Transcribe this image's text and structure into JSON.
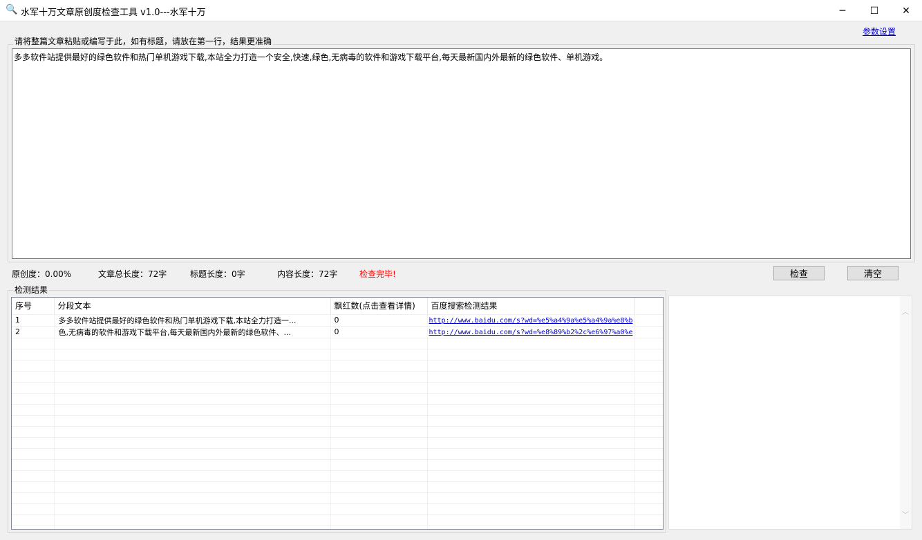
{
  "window": {
    "title": "水军十万文章原创度检查工具  v1.0---水军十万",
    "minimize": "─",
    "maximize": "☐",
    "close": "✕"
  },
  "settings_link": "参数设置",
  "input_group": {
    "label": "请将整篇文章粘贴或编写于此，如有标题，请放在第一行，结果更准确",
    "text": "多多软件站提供最好的绿色软件和热门单机游戏下载,本站全力打造一个安全,快速,绿色,无病毒的软件和游戏下载平台,每天最新国内外最新的绿色软件、单机游戏。"
  },
  "status": {
    "originality": "原创度：0.00%",
    "total_length": "文章总长度：72字",
    "title_length": "标题长度：0字",
    "content_length": "内容长度：72字",
    "message": "检查完毕!",
    "message_color": "#ff0000"
  },
  "buttons": {
    "check": "检查",
    "clear": "清空"
  },
  "results": {
    "label": "检测结果",
    "columns": [
      "序号",
      "分段文本",
      "飘红数(点击查看详情)",
      "百度搜索检测结果"
    ],
    "rows": [
      {
        "index": "1",
        "text": "多多软件站提供最好的绿色软件和热门单机游戏下载,本站全力打造一...",
        "red_count": "0",
        "link": "http://www.baidu.com/s?wd=%e5%a4%9a%e5%a4%9a%e8%b"
      },
      {
        "index": "2",
        "text": "色,无病毒的软件和游戏下载平台,每天最新国内外最新的绿色软件、...",
        "red_count": "0",
        "link": "http://www.baidu.com/s?wd=%e8%89%b2%2c%e6%97%a0%e"
      }
    ]
  }
}
